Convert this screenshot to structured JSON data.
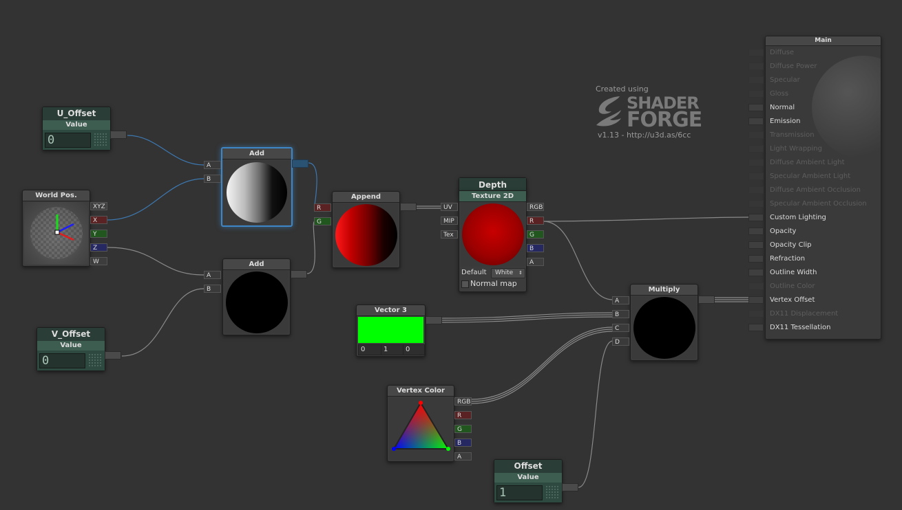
{
  "watermark": {
    "created_using": "Created using",
    "logo_line1": "SHADER",
    "logo_line2": "FORGE",
    "version": "v1.13 - http://u3d.as/6cc"
  },
  "nodes": {
    "u_offset": {
      "name": "U_Offset",
      "subtitle": "Value",
      "value": "0"
    },
    "v_offset": {
      "name": "V_Offset",
      "subtitle": "Value",
      "value": "0"
    },
    "offset": {
      "name": "Offset",
      "subtitle": "Value",
      "value": "1"
    },
    "world_pos": {
      "title": "World Pos.",
      "outputs": [
        "XYZ",
        "X",
        "Y",
        "Z",
        "W"
      ]
    },
    "add1": {
      "title": "Add",
      "inputs": [
        "A",
        "B"
      ]
    },
    "add2": {
      "title": "Add",
      "inputs": [
        "A",
        "B"
      ]
    },
    "append": {
      "title": "Append",
      "inputs": [
        "R",
        "G"
      ]
    },
    "depth": {
      "name": "Depth",
      "title": "Texture 2D",
      "inputs": [
        "UV",
        "MIP",
        "Tex"
      ],
      "outputs": [
        "RGB",
        "R",
        "G",
        "B",
        "A"
      ],
      "default_label": "Default",
      "default_value": "White",
      "normal_map_label": "Normal map"
    },
    "vector3": {
      "title": "Vector 3",
      "values": [
        "0",
        "1",
        "0"
      ],
      "color": "#00ff00"
    },
    "vertex_color": {
      "title": "Vertex Color",
      "outputs": [
        "RGB",
        "R",
        "G",
        "B",
        "A"
      ]
    },
    "multiply": {
      "title": "Multiply",
      "inputs": [
        "A",
        "B",
        "C",
        "D"
      ]
    }
  },
  "main": {
    "title": "Main",
    "inputs": [
      {
        "label": "Diffuse",
        "connected": false
      },
      {
        "label": "Diffuse Power",
        "connected": false
      },
      {
        "label": "Specular",
        "connected": false
      },
      {
        "label": "Gloss",
        "connected": false
      },
      {
        "label": "Normal",
        "connected": true
      },
      {
        "label": "Emission",
        "connected": true
      },
      {
        "label": "Transmission",
        "connected": false
      },
      {
        "label": "Light Wrapping",
        "connected": false
      },
      {
        "label": "Diffuse Ambient Light",
        "connected": false
      },
      {
        "label": "Specular Ambient Light",
        "connected": false
      },
      {
        "label": "Diffuse Ambient Occlusion",
        "connected": false
      },
      {
        "label": "Specular Ambient Occlusion",
        "connected": false
      },
      {
        "label": "Custom Lighting",
        "connected": true
      },
      {
        "label": "Opacity",
        "connected": true
      },
      {
        "label": "Opacity Clip",
        "connected": true
      },
      {
        "label": "Refraction",
        "connected": true
      },
      {
        "label": "Outline Width",
        "connected": true
      },
      {
        "label": "Outline Color",
        "connected": false
      },
      {
        "label": "Vertex Offset",
        "connected": true
      },
      {
        "label": "DX11 Displacement",
        "connected": false
      },
      {
        "label": "DX11 Tessellation",
        "connected": true
      }
    ]
  },
  "colors": {
    "canvas": "#333333",
    "wire": "#8a8a8a",
    "selected_wire": "#3d87c8",
    "property_node": "#2e4a40",
    "selection": "#3d87c8"
  }
}
